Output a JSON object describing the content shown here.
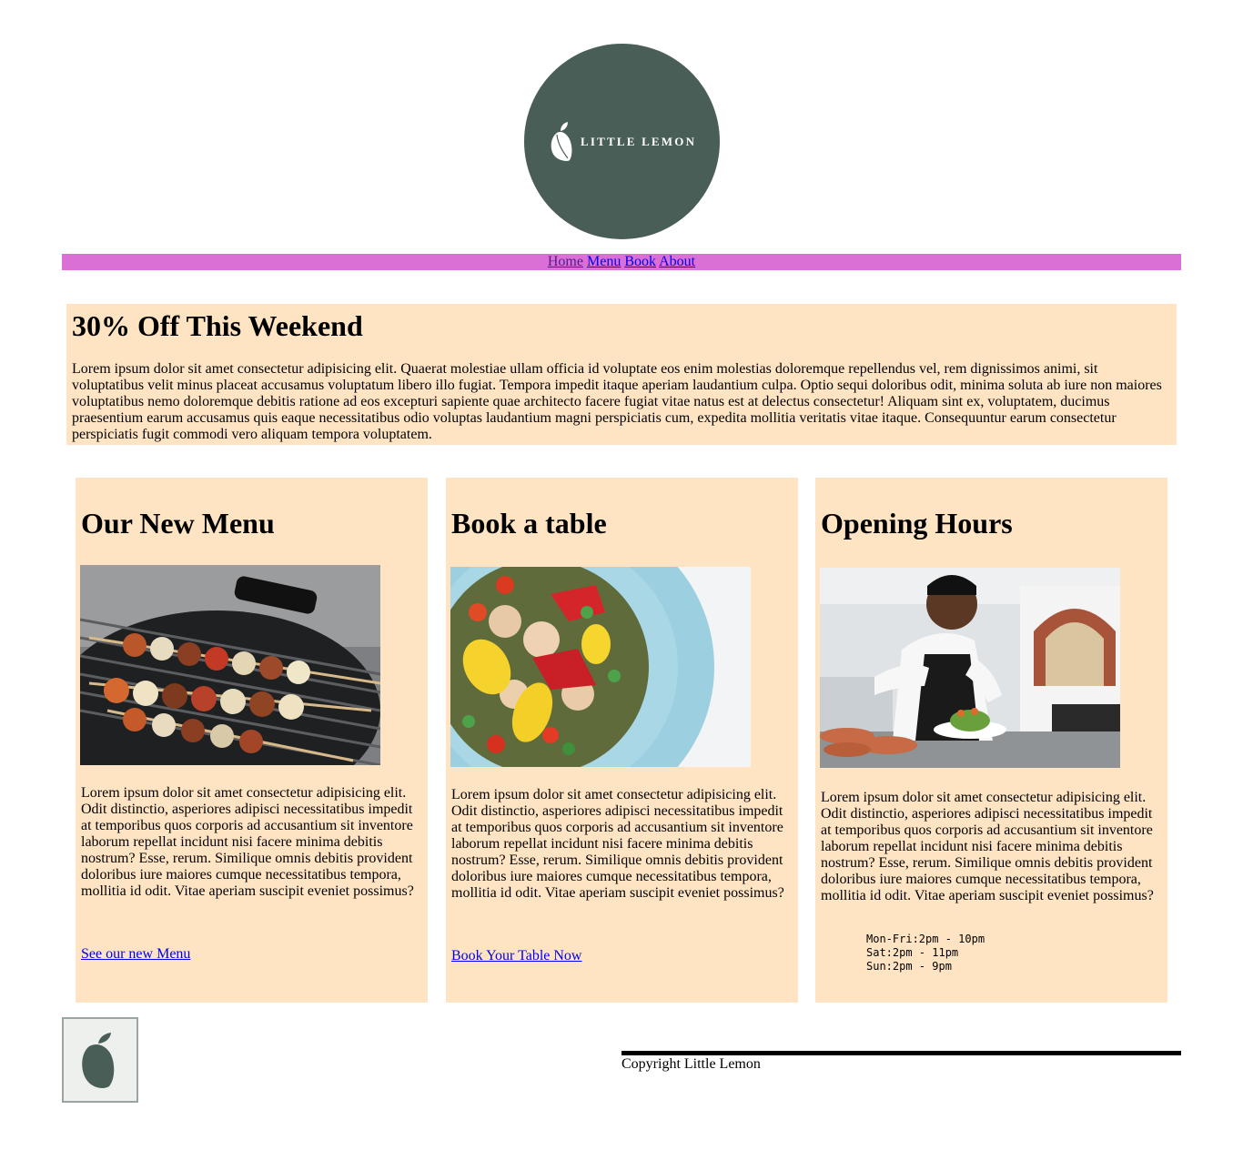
{
  "header": {
    "logo_text": "LITTLE LEMON",
    "logo_color": "#495e57"
  },
  "nav": {
    "background": "#da70d6",
    "items": [
      "Home",
      "Menu",
      "Book",
      "About"
    ]
  },
  "promo": {
    "title": "30% Off This Weekend",
    "body": "Lorem ipsum dolor sit amet consectetur adipisicing elit. Quaerat molestiae ullam officia id voluptate eos enim molestias doloremque repellendus vel, rem dignissimos animi, sit voluptatibus velit minus placeat accusamus voluptatum libero illo fugiat. Tempora impedit itaque aperiam laudantium culpa. Optio sequi doloribus odit, minima soluta ab iure non maiores voluptatibus nemo doloremque debitis ratione ad eos excepturi sapiente quae architecto facere fugiat vitae natus est at delectus consectetur! Aliquam sint ex, voluptatem, ducimus praesentium earum accusamus quis eaque necessitatibus odio voluptas laudantium magni perspiciatis cum, expedita mollitia veritatis vitae itaque. Consequuntur earum consectetur perspiciatis fugit commodi vero aliquam tempora voluptatem."
  },
  "cards": [
    {
      "title": "Our New Menu",
      "image": "grilled-skewers-photo",
      "body": "Lorem ipsum dolor sit amet consectetur adipisicing elit. Odit distinctio, asperiores adipisci necessitatibus impedit at temporibus quos corporis ad accusantium sit inventore laborum repellat incidunt nisi facere minima debitis nostrum? Esse, rerum. Similique omnis debitis provident doloribus iure maiores cumque necessitatibus tempora, mollitia id odit. Vitae aperiam suscipit eveniet possimus?",
      "link": "See our new Menu"
    },
    {
      "title": "Book a table",
      "image": "salad-plate-photo",
      "body": "Lorem ipsum dolor sit amet consectetur adipisicing elit. Odit distinctio, asperiores adipisci necessitatibus impedit at temporibus quos corporis ad accusantium sit inventore laborum repellat incidunt nisi facere minima debitis nostrum? Esse, rerum. Similique omnis debitis provident doloribus iure maiores cumque necessitatibus tempora, mollitia id odit. Vitae aperiam suscipit eveniet possimus?",
      "link": "Book Your Table Now"
    },
    {
      "title": "Opening Hours",
      "image": "chef-plating-photo",
      "body": "Lorem ipsum dolor sit amet consectetur adipisicing elit. Odit distinctio, asperiores adipisci necessitatibus impedit at temporibus quos corporis ad accusantium sit inventore laborum repellat incidunt nisi facere minima debitis nostrum? Esse, rerum. Similique omnis debitis provident doloribus iure maiores cumque necessitatibus tempora, mollitia id odit. Vitae aperiam suscipit eveniet possimus?",
      "hours": [
        "Mon-Fri:2pm - 10pm",
        "Sat:2pm - 11pm",
        "Sun:2pm - 9pm"
      ]
    }
  ],
  "card_background": "#ffe4c4",
  "footer": {
    "copyright": "Copyright Little Lemon"
  }
}
